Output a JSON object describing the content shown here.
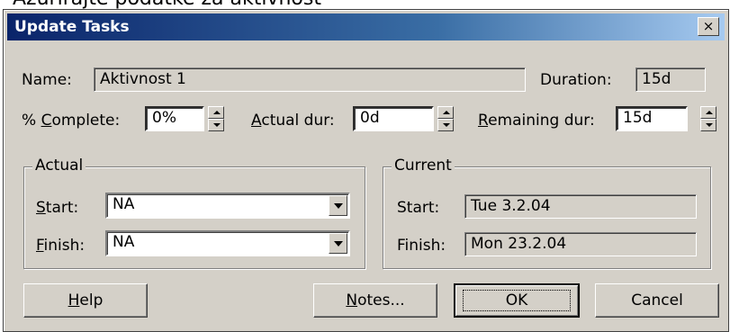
{
  "page_caption": "Ažurirajte podatke za aktivnost",
  "dialog": {
    "title": "Update Tasks",
    "close_symbol": "×"
  },
  "fields": {
    "name_label": "Name:",
    "name_value": "Aktivnost 1",
    "duration_label": "Duration:",
    "duration_value": "15d",
    "complete_label_pre": "% ",
    "complete_label_u": "C",
    "complete_label_post": "omplete:",
    "complete_value": "0%",
    "actual_dur_label_u": "A",
    "actual_dur_label_post": "ctual dur:",
    "actual_dur_value": "0d",
    "remaining_label_u": "R",
    "remaining_label_post": "emaining dur:",
    "remaining_value": "15d"
  },
  "actual_group": {
    "label": "Actual",
    "start_label_u": "S",
    "start_label_post": "tart:",
    "start_value": "NA",
    "finish_label_u": "F",
    "finish_label_post": "inish:",
    "finish_value": "NA"
  },
  "current_group": {
    "label": "Current",
    "start_label": "Start:",
    "start_value": "Tue 3.2.04",
    "finish_label": "Finish:",
    "finish_value": "Mon 23.2.04"
  },
  "buttons": {
    "help_u": "H",
    "help_post": "elp",
    "notes_u": "N",
    "notes_post": "otes...",
    "ok": "OK",
    "cancel": "Cancel"
  },
  "icons": [
    "close-icon",
    "spin-up-icon",
    "spin-down-icon",
    "dropdown-arrow-icon"
  ]
}
